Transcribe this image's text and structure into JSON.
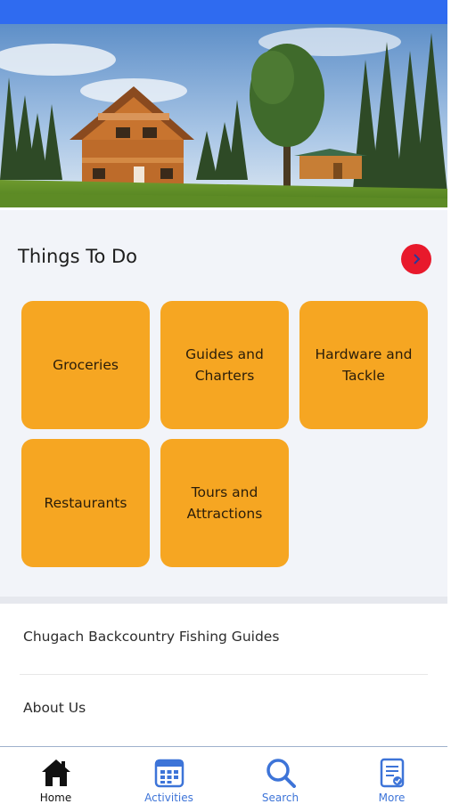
{
  "section": {
    "title": "Things To Do",
    "categories": [
      {
        "label": "Groceries"
      },
      {
        "label": "Guides and Charters"
      },
      {
        "label": "Hardware and Tackle"
      },
      {
        "label": "Restaurants"
      },
      {
        "label": "Tours and Attractions"
      }
    ]
  },
  "list": {
    "items": [
      {
        "label": "Chugach Backcountry Fishing Guides"
      },
      {
        "label": "About Us"
      }
    ]
  },
  "tabbar": {
    "tabs": [
      {
        "label": "Home",
        "icon": "home-icon",
        "active": true
      },
      {
        "label": "Activities",
        "icon": "calendar-icon",
        "active": false
      },
      {
        "label": "Search",
        "icon": "search-icon",
        "active": false
      },
      {
        "label": "More",
        "icon": "document-icon",
        "active": false
      }
    ]
  },
  "colors": {
    "header_blue": "#2f6bf0",
    "tile_orange": "#f6a622",
    "arrow_red": "#e8192c",
    "tab_blue": "#3d74d8"
  }
}
